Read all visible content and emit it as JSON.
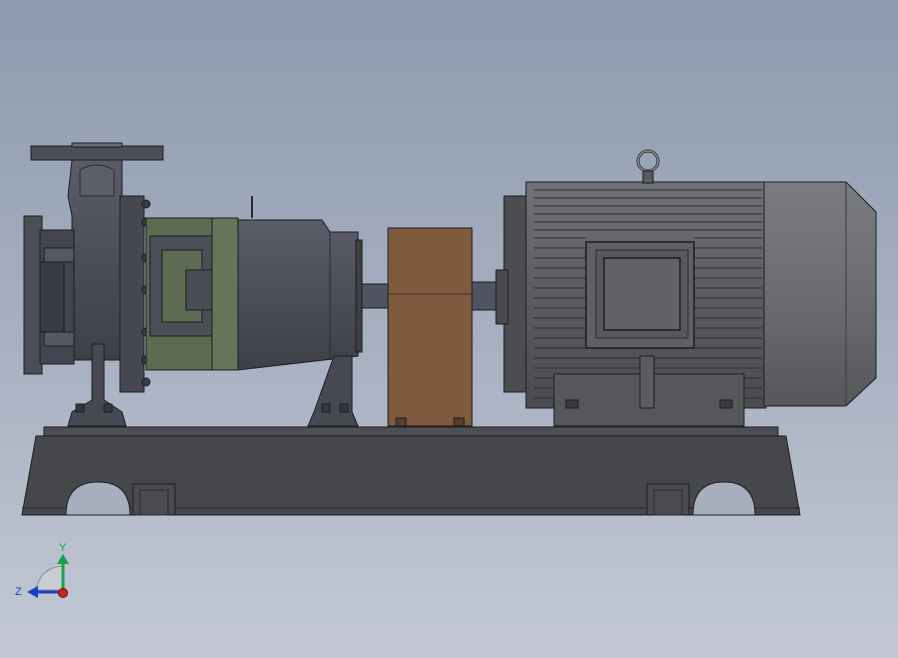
{
  "viewport": {
    "background_top": "#8e9aae",
    "background_bottom": "#c3c8d4"
  },
  "model": {
    "parts": [
      "pump-casing",
      "bearing-bracket",
      "bearing-housing",
      "coupling-guard",
      "electric-motor",
      "base-frame"
    ],
    "colors": {
      "steel": "#4b4e57",
      "steel_dark": "#3a3c43",
      "bracket_green": "#5c6b52",
      "guard_brown": "#7f5a3f",
      "motor": "#5a5c60",
      "motor_fan_cover": "#6c6d70",
      "base": "#46474b"
    }
  },
  "triad": {
    "y_label": "Y",
    "z_label": "Z",
    "y_color": "#1aa04a",
    "z_color": "#1f3fbf",
    "origin_color": "#cc2222"
  }
}
